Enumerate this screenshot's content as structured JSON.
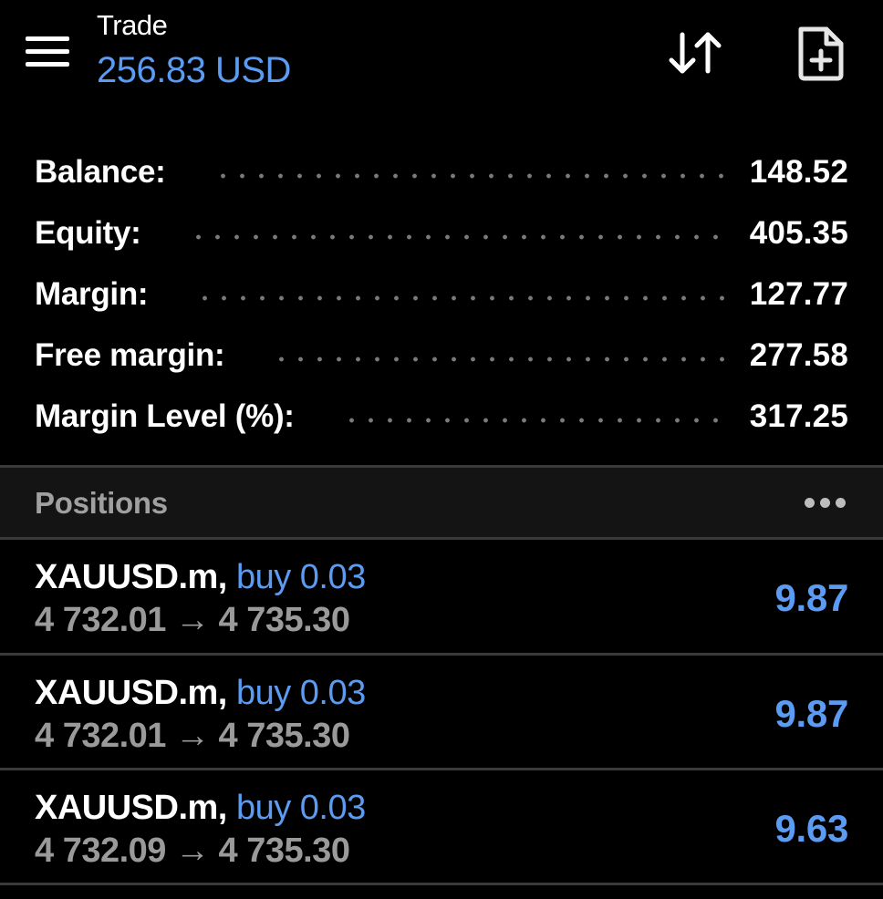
{
  "header": {
    "title": "Trade",
    "account_value": "256.83 USD",
    "menu_icon": "hamburger-icon",
    "sort_icon": "sort-arrows-icon",
    "new_order_icon": "document-plus-icon"
  },
  "summary": {
    "rows": [
      {
        "label": "Balance:",
        "value": "148.52"
      },
      {
        "label": "Equity:",
        "value": "405.35"
      },
      {
        "label": "Margin:",
        "value": "127.77"
      },
      {
        "label": "Free margin:",
        "value": "277.58"
      },
      {
        "label": "Margin Level (%):",
        "value": "317.25"
      }
    ]
  },
  "positions": {
    "title": "Positions",
    "more_icon": "more-horizontal-icon",
    "items": [
      {
        "symbol": "XAUUSD.m,",
        "type": "buy 0.03",
        "prices": "4 732.01 → 4 735.30",
        "profit": "9.87"
      },
      {
        "symbol": "XAUUSD.m,",
        "type": "buy 0.03",
        "prices": "4 732.01 → 4 735.30",
        "profit": "9.87"
      },
      {
        "symbol": "XAUUSD.m,",
        "type": "buy 0.03",
        "prices": "4 732.09 → 4 735.30",
        "profit": "9.63"
      }
    ]
  },
  "colors": {
    "background": "#000000",
    "accent": "#5b9cf2",
    "text": "#ffffff",
    "muted": "#9a9a9a",
    "divider": "#3a3a3a"
  }
}
